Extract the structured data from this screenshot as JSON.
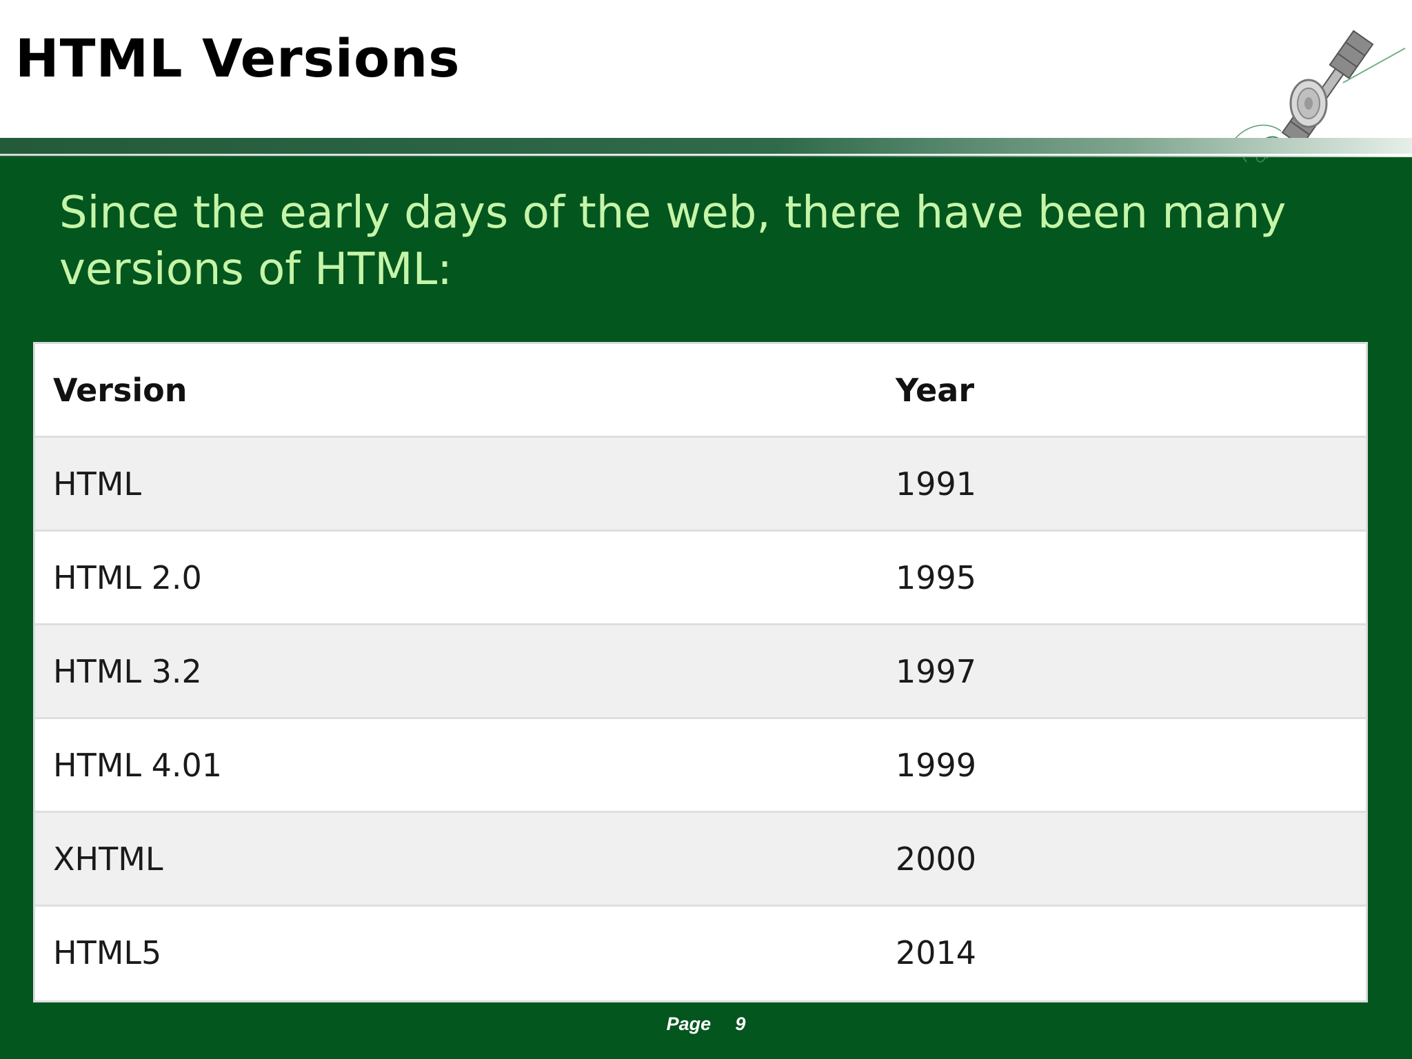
{
  "slide": {
    "title": "HTML Versions",
    "subtitle": "Since the early days of the web, there have been many versions of HTML:"
  },
  "table": {
    "headers": [
      "Version",
      "Year"
    ],
    "rows": [
      [
        "HTML",
        "1991"
      ],
      [
        "HTML 2.0",
        "1995"
      ],
      [
        "HTML 3.2",
        "1997"
      ],
      [
        "HTML 4.01",
        "1999"
      ],
      [
        "XHTML",
        "2000"
      ],
      [
        "HTML5",
        "2014"
      ]
    ]
  },
  "footer": {
    "page_label": "Page  9"
  },
  "colors": {
    "background": "#04561f",
    "subtitle_text": "#c6f5a8",
    "table_row_alt": "#f0f0f0"
  },
  "icons": {
    "logo": "satellite-icon"
  }
}
